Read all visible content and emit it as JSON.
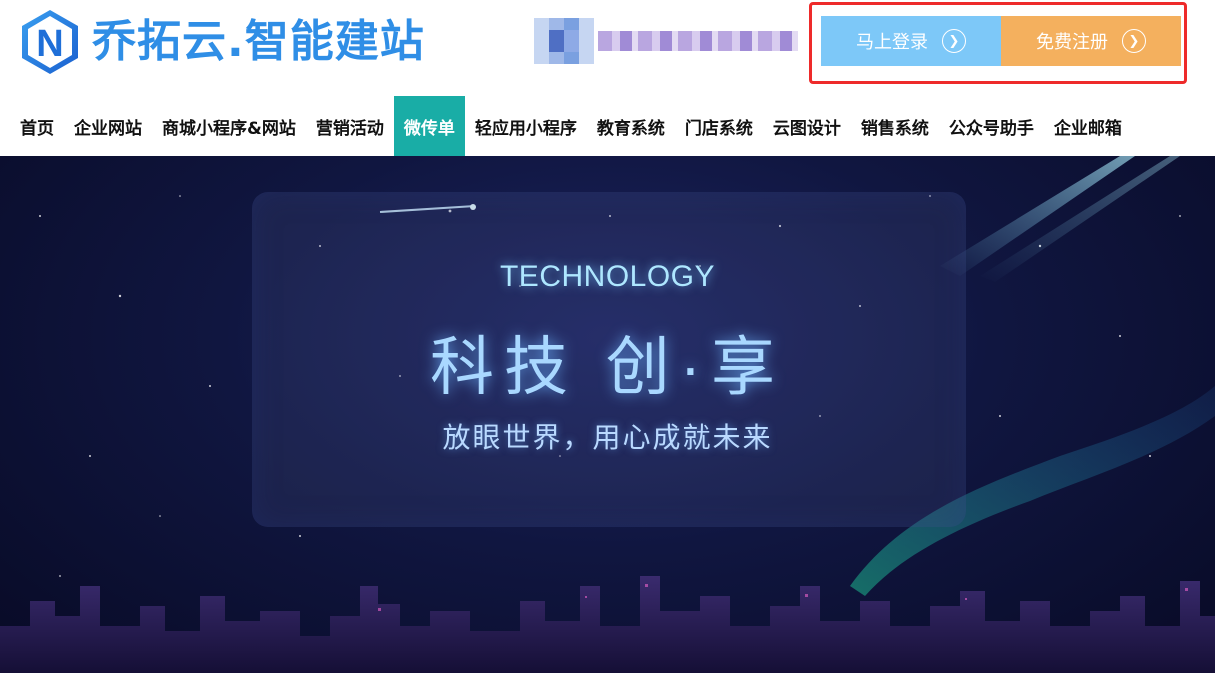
{
  "brand": {
    "name": "乔拓云.智能建站",
    "logo_letter": "N",
    "primary_color": "#2f8ee6"
  },
  "user": {
    "blurred": true
  },
  "auth": {
    "login_label": "马上登录",
    "register_label": "免费注册",
    "login_color": "#7dc8f8",
    "register_color": "#f4b05e",
    "highlight_color": "#ee2a2a",
    "arrow_icon": "chevron-right-circle-icon"
  },
  "nav": {
    "active_color": "#19ada6",
    "items": [
      {
        "label": "首页"
      },
      {
        "label": "企业网站"
      },
      {
        "label": "商城小程序&网站"
      },
      {
        "label": "营销活动"
      },
      {
        "label": "微传单",
        "active": true
      },
      {
        "label": "轻应用小程序"
      },
      {
        "label": "教育系统"
      },
      {
        "label": "门店系统"
      },
      {
        "label": "云图设计"
      },
      {
        "label": "销售系统"
      },
      {
        "label": "公众号助手"
      },
      {
        "label": "企业邮箱"
      }
    ]
  },
  "hero": {
    "eyebrow": "TECHNOLOGY",
    "title": "科技 创·享",
    "subtitle": "放眼世界，用心成就未来"
  }
}
